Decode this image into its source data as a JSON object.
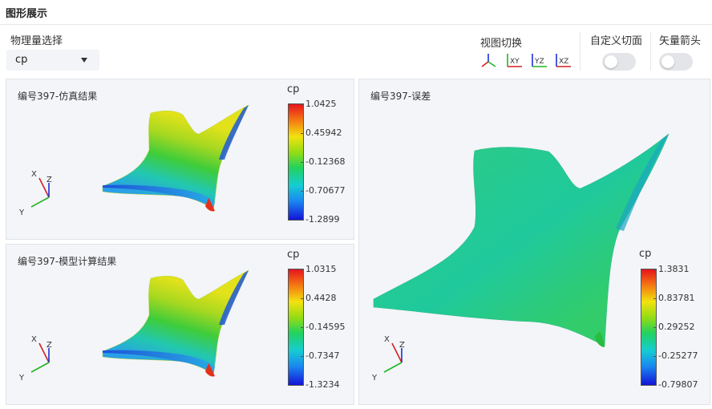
{
  "header": {
    "title": "图形展示"
  },
  "controls": {
    "quantity_label": "物理量选择",
    "quantity_value": "cp",
    "view_switch_label": "视图切换",
    "view_buttons": [
      "XY",
      "YZ",
      "XZ"
    ],
    "custom_section_label": "自定义切面",
    "vector_arrow_label": "矢量箭头",
    "custom_section_on": false,
    "vector_arrow_on": false
  },
  "panels": {
    "sim": {
      "title": "编号397-仿真结果",
      "colorbar": {
        "title": "cp",
        "ticks": [
          "1.0425",
          "0.45942",
          "-0.12368",
          "-0.70677",
          "-1.2899"
        ]
      }
    },
    "model": {
      "title": "编号397-模型计算结果",
      "colorbar": {
        "title": "cp",
        "ticks": [
          "1.0315",
          "0.4428",
          "-0.14595",
          "-0.7347",
          "-1.3234"
        ]
      }
    },
    "error": {
      "title": "编号397-误差",
      "colorbar": {
        "title": "cp",
        "ticks": [
          "1.3831",
          "0.83781",
          "0.29252",
          "-0.25277",
          "-0.79807"
        ]
      }
    }
  },
  "axes": {
    "x": "X",
    "y": "Y",
    "z": "Z"
  },
  "colors": {
    "axis_x": "#d42020",
    "axis_y": "#22b422",
    "axis_z": "#1a2fd8",
    "panel_bg": "#f3f5f8"
  }
}
